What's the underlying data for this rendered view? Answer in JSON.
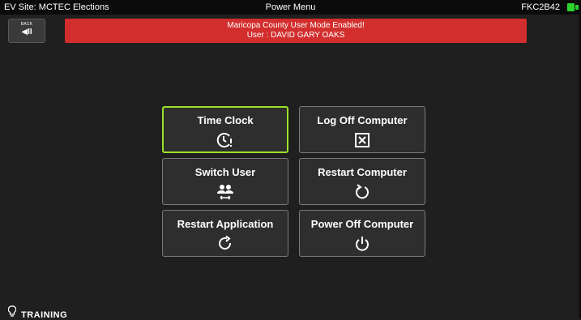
{
  "titlebar": {
    "site": "EV Site: MCTEC Elections",
    "title": "Power Menu",
    "device": "FKC2B42"
  },
  "back_button": {
    "label": "BACK",
    "icon": "back-arrow-icon"
  },
  "banner": {
    "line1": "Maricopa County User Mode Enabled!",
    "line2": "User : DAVID GARY OAKS",
    "color": "#d22e2e"
  },
  "tiles": [
    {
      "label": "Time Clock",
      "icon": "clock-alert-icon",
      "selected": true
    },
    {
      "label": "Log Off Computer",
      "icon": "close-box-icon",
      "selected": false
    },
    {
      "label": "Switch User",
      "icon": "switch-user-icon",
      "selected": false
    },
    {
      "label": "Restart Computer",
      "icon": "restart-icon",
      "selected": false
    },
    {
      "label": "Restart Application",
      "icon": "refresh-icon",
      "selected": false
    },
    {
      "label": "Power Off Computer",
      "icon": "power-icon",
      "selected": false
    }
  ],
  "footer": {
    "label": "TRAINING",
    "icon": "lightbulb-icon"
  },
  "colors": {
    "background": "#1f1f1f",
    "selected_border": "#9de02a",
    "battery": "#2bd42b"
  }
}
